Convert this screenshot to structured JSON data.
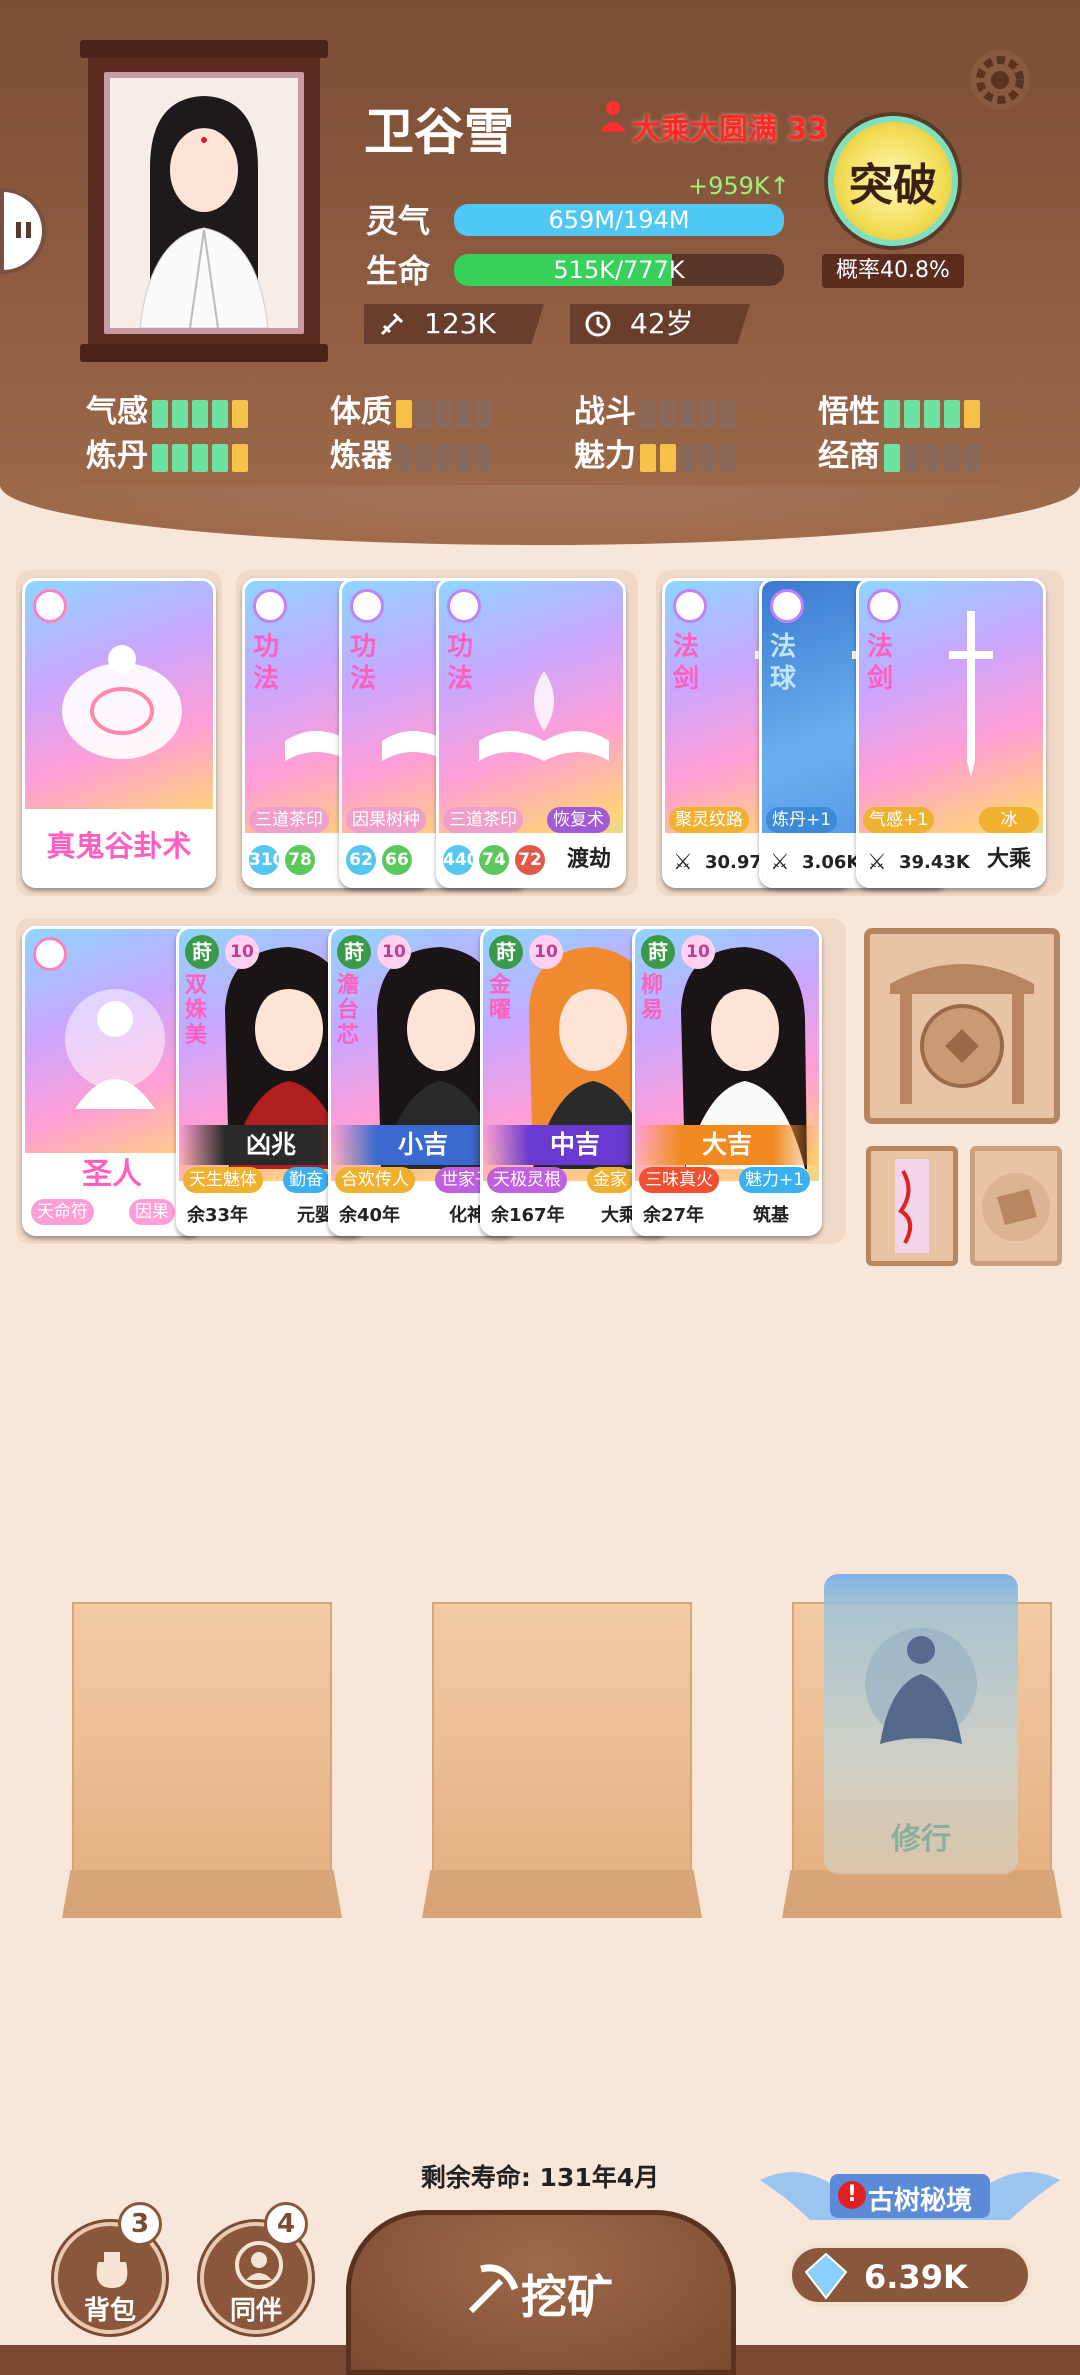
{
  "player": {
    "name": "卫谷雪",
    "realm": "大乘大圆满 33",
    "spirit_label": "灵气",
    "spirit_value": "659M/194M",
    "spirit_fill": 1.0,
    "spirit_gain": "+959K↑",
    "life_label": "生命",
    "life_value": "515K/777K",
    "life_fill": 0.66,
    "attack": "123K",
    "age": "42岁",
    "breakthrough_label": "突破",
    "probability": "概率40.8%"
  },
  "attributes": [
    {
      "label": "气感",
      "segments": [
        "g",
        "g",
        "g",
        "g",
        "y"
      ]
    },
    {
      "label": "体质",
      "segments": [
        "y",
        "n",
        "n",
        "n",
        "n"
      ]
    },
    {
      "label": "战斗",
      "segments": [
        "n",
        "n",
        "n",
        "n",
        "n"
      ]
    },
    {
      "label": "悟性",
      "segments": [
        "g",
        "g",
        "g",
        "g",
        "y"
      ]
    },
    {
      "label": "炼丹",
      "segments": [
        "g",
        "g",
        "g",
        "g",
        "y"
      ]
    },
    {
      "label": "炼器",
      "segments": [
        "n",
        "n",
        "n",
        "n",
        "n"
      ]
    },
    {
      "label": "魅力",
      "segments": [
        "y",
        "y",
        "n",
        "n",
        "n"
      ]
    },
    {
      "label": "经商",
      "segments": [
        "g",
        "n",
        "n",
        "n",
        "n"
      ]
    }
  ],
  "cards_row1": {
    "divination": {
      "title": "真鬼谷卦术"
    },
    "techniques": [
      {
        "type": "功法",
        "tag": "三道茶印",
        "nums": [
          "310",
          "78"
        ]
      },
      {
        "type": "功法",
        "tag": "因果树种",
        "nums": [
          "62",
          "66"
        ]
      },
      {
        "type": "功法",
        "tag": "三道茶印",
        "tag2": "恢复术",
        "nums": [
          "440",
          "74",
          "72"
        ],
        "label": "渡劫"
      }
    ],
    "weapons": [
      {
        "type": "法剑",
        "tag": "聚灵纹路",
        "power": "30.97K"
      },
      {
        "type": "法球",
        "tag": "炼丹+1",
        "power": "3.06K"
      },
      {
        "type": "法剑",
        "tag": "气感+1",
        "tag2": "冰",
        "power": "39.43K",
        "label": "大乘"
      }
    ]
  },
  "cards_row2": {
    "sage": {
      "title": "圣人",
      "tags": [
        "天命符",
        "因果"
      ]
    },
    "companions": [
      {
        "level": "10",
        "name": "双姝美",
        "fortune": "凶兆",
        "tag": "天生魅体",
        "tag2": "勤奋",
        "life": "余33年",
        "stage": "元婴"
      },
      {
        "level": "10",
        "name": "澹台芯",
        "fortune": "小吉",
        "tag": "合欢传人",
        "tag2": "世家子",
        "life": "余40年",
        "stage": "化神"
      },
      {
        "level": "10",
        "name": "金曜",
        "fortune": "中吉",
        "tag": "天极灵根",
        "tag2": "金家",
        "life": "余167年",
        "stage": "大乘"
      },
      {
        "level": "10",
        "name": "柳易",
        "fortune": "大吉",
        "tag": "三味真火",
        "tag2": "魅力+1",
        "life": "余27年",
        "stage": "筑基"
      }
    ],
    "companion_badge": "莳"
  },
  "slots": {
    "practice_label": "修行"
  },
  "footer": {
    "lifespan": "剩余寿命: 131年4月",
    "bag_label": "背包",
    "bag_count": "3",
    "partner_label": "同伴",
    "partner_count": "4",
    "mine_label": "挖矿",
    "secret_realm": "古树秘境",
    "gems": "6.39K"
  },
  "colors": {
    "accent_brown": "#7a4d35",
    "spirit_bar": "#4fc8f5",
    "life_bar": "#36d05a",
    "realm_red": "#ff2828"
  }
}
